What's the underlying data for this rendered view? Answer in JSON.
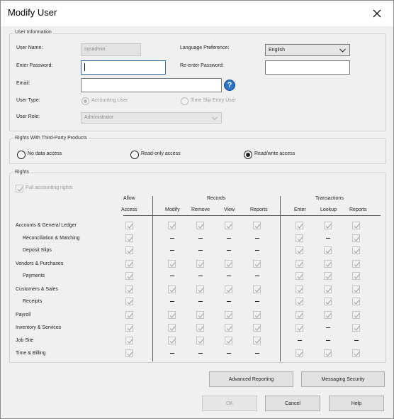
{
  "window": {
    "title": "Modify User"
  },
  "user_info": {
    "legend": "User Information",
    "user_name_label": "User Name:",
    "user_name_value": "sysadmin",
    "enter_password_label": "Enter Password:",
    "email_label": "Email:",
    "user_type_label": "User Type:",
    "user_type_accounting": "Accounting User",
    "user_type_timeslip": "Time Slip Entry User",
    "user_role_label": "User Role:",
    "user_role_value": "Administrator",
    "language_label": "Language Preference:",
    "language_value": "English",
    "reenter_password_label": "Re-enter Password:",
    "help_glyph": "?"
  },
  "third_party": {
    "legend": "Rights With Third-Party Products",
    "options": [
      "No data access",
      "Read-only access",
      "Read/write access"
    ],
    "selected": "Read/write access"
  },
  "rights": {
    "legend": "Rights",
    "full_label": "Full accounting rights",
    "group_allow_top": "Allow",
    "group_allow_bottom": "Access",
    "group_records": "Records",
    "group_transactions": "Transactions",
    "col_modify": "Modify",
    "col_remove": "Remove",
    "col_view": "View",
    "col_reports": "Reports",
    "col_enter": "Enter",
    "col_lookup": "Lookup",
    "col_treports": "Reports",
    "rows": [
      {
        "label": "Accounts & General Ledger",
        "cells": "ccccccccc"
      },
      {
        "label": "Reconciliation & Matching",
        "cells": "c----c-c"
      },
      {
        "label": "Deposit Slips",
        "cells": "c----ccc"
      },
      {
        "label": "Vendors & Purchases",
        "cells": "cccccccc"
      },
      {
        "label": "Payments",
        "cells": "c----ccc"
      },
      {
        "label": "Customers & Sales",
        "cells": "cccccccc"
      },
      {
        "label": "Receipts",
        "cells": "c----ccc"
      },
      {
        "label": "Payroll",
        "cells": "cccccccc"
      },
      {
        "label": "Inventory & Services",
        "cells": "ccccccc-c"
      },
      {
        "label": "Job Site",
        "cells": "ccccc---"
      },
      {
        "label": "Time & Billing",
        "cells": "c----ccc"
      }
    ]
  },
  "buttons": {
    "advanced_reporting": "Advanced Reporting",
    "messaging_security": "Messaging Security",
    "ok": "OK",
    "cancel": "Cancel",
    "help": "Help"
  },
  "icons": {
    "close": "close-icon",
    "dropdown": "chevron-down-icon",
    "help": "help-icon",
    "check": "checkmark-icon"
  }
}
